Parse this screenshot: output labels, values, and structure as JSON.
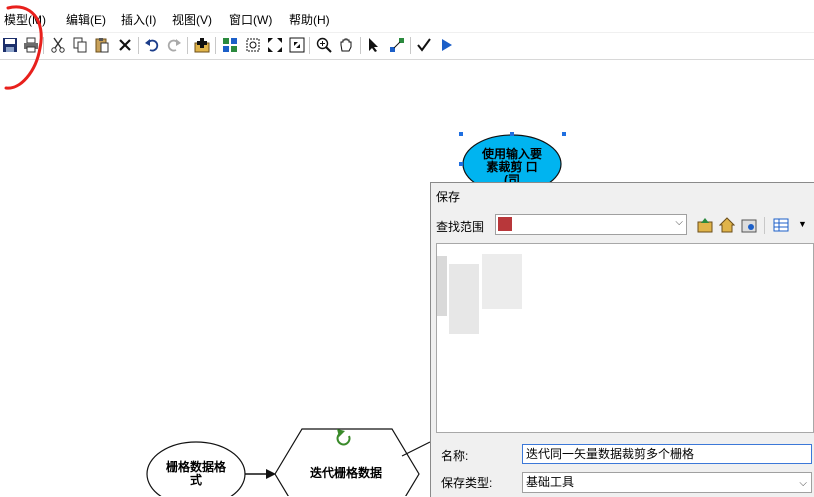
{
  "menu": {
    "items": [
      {
        "label": "模型(M)"
      },
      {
        "label": "编辑(E)"
      },
      {
        "label": "插入(I)"
      },
      {
        "label": "视图(V)"
      },
      {
        "label": "窗口(W)"
      },
      {
        "label": "帮助(H)"
      }
    ]
  },
  "toolbar": {
    "icons": [
      "save-icon",
      "print-icon",
      "cut-icon",
      "copy-icon",
      "paste-icon",
      "delete-icon",
      "undo-icon",
      "redo-icon",
      "add-data-icon",
      "auto-layout-icon",
      "full-extent-icon",
      "fixed-zoom-in-icon",
      "fixed-zoom-out-icon",
      "zoom-in-icon",
      "pan-icon",
      "select-icon",
      "connect-icon",
      "validate-icon",
      "run-icon"
    ]
  },
  "model": {
    "tool_node": "使用输入要素裁剪 口 (司",
    "raster_format_node": "栅格数据格式",
    "iterator_node": "迭代栅格数据"
  },
  "dialog": {
    "title": "保存",
    "look_in_label": "查找范围",
    "name_label": "名称:",
    "name_value": "迭代同一矢量数据裁剪多个栅格",
    "type_label": "保存类型:",
    "type_value": "基础工具"
  },
  "colors": {
    "tool_fill": "#00b4f0",
    "annotation_red": "#e8201c",
    "selection_handle": "#1f6fe0"
  }
}
